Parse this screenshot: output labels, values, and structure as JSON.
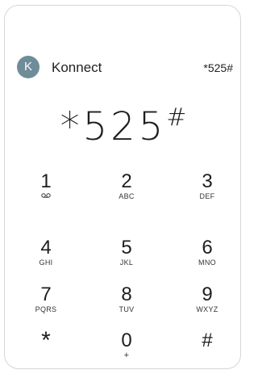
{
  "header": {
    "avatar_initial": "K",
    "contact_name": "Konnect",
    "number": "*525#"
  },
  "display": {
    "main": "*525",
    "suffix": "#"
  },
  "keypad": {
    "keys": [
      {
        "digit": "1",
        "letters": ""
      },
      {
        "digit": "2",
        "letters": "ABC"
      },
      {
        "digit": "3",
        "letters": "DEF"
      },
      {
        "digit": "4",
        "letters": "GHI"
      },
      {
        "digit": "5",
        "letters": "JKL"
      },
      {
        "digit": "6",
        "letters": "MNO"
      },
      {
        "digit": "7",
        "letters": "PQRS"
      },
      {
        "digit": "8",
        "letters": "TUV"
      },
      {
        "digit": "9",
        "letters": "WXYZ"
      },
      {
        "digit": "*",
        "letters": ""
      },
      {
        "digit": "0",
        "letters": "+"
      },
      {
        "digit": "#",
        "letters": ""
      }
    ]
  },
  "colors": {
    "avatar_bg": "#6f8c99",
    "text": "#1e1e1e",
    "border": "#d6d6d6"
  }
}
